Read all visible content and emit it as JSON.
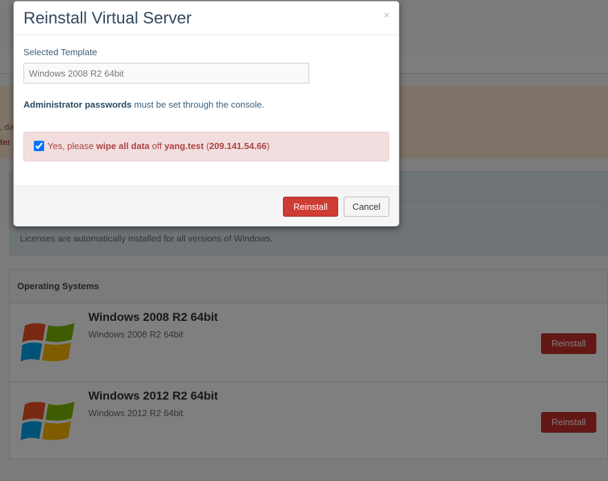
{
  "modal": {
    "title": "Reinstall Virtual Server",
    "close_glyph": "×",
    "template_label": "Selected Template",
    "template_value": "Windows 2008 R2 64bit",
    "admin_note_bold": "Administrator passwords",
    "admin_note_rest": " must be set through the console.",
    "confirm": {
      "checked": true,
      "prefix": "Yes, please ",
      "wipe": "wipe all data",
      "middle": " off ",
      "host": "yang.test",
      "ip_open": " (",
      "ip": "209.141.54.66",
      "ip_close": ")"
    },
    "reinstall_label": "Reinstall",
    "cancel_label": "Cancel"
  },
  "background": {
    "alert_line1": ", da",
    "alert_line2": "ter",
    "info_text": "Licenses are automatically installed for all versions of Windows.",
    "os_panel_title": "Operating Systems",
    "os_items": [
      {
        "name": "Windows 2008 R2 64bit",
        "desc": "Windows 2008 R2 64bit",
        "button": "Reinstall",
        "icon": "windows-logo-icon"
      },
      {
        "name": "Windows 2012 R2 64bit",
        "desc": "Windows 2012 R2 64bit",
        "button": "Reinstall",
        "icon": "windows-logo-icon"
      }
    ]
  },
  "colors": {
    "danger": "#cf3b35",
    "title": "#34495e",
    "alert_bg": "#f2dede",
    "overlay": "rgba(0,0,0,0.5)"
  }
}
